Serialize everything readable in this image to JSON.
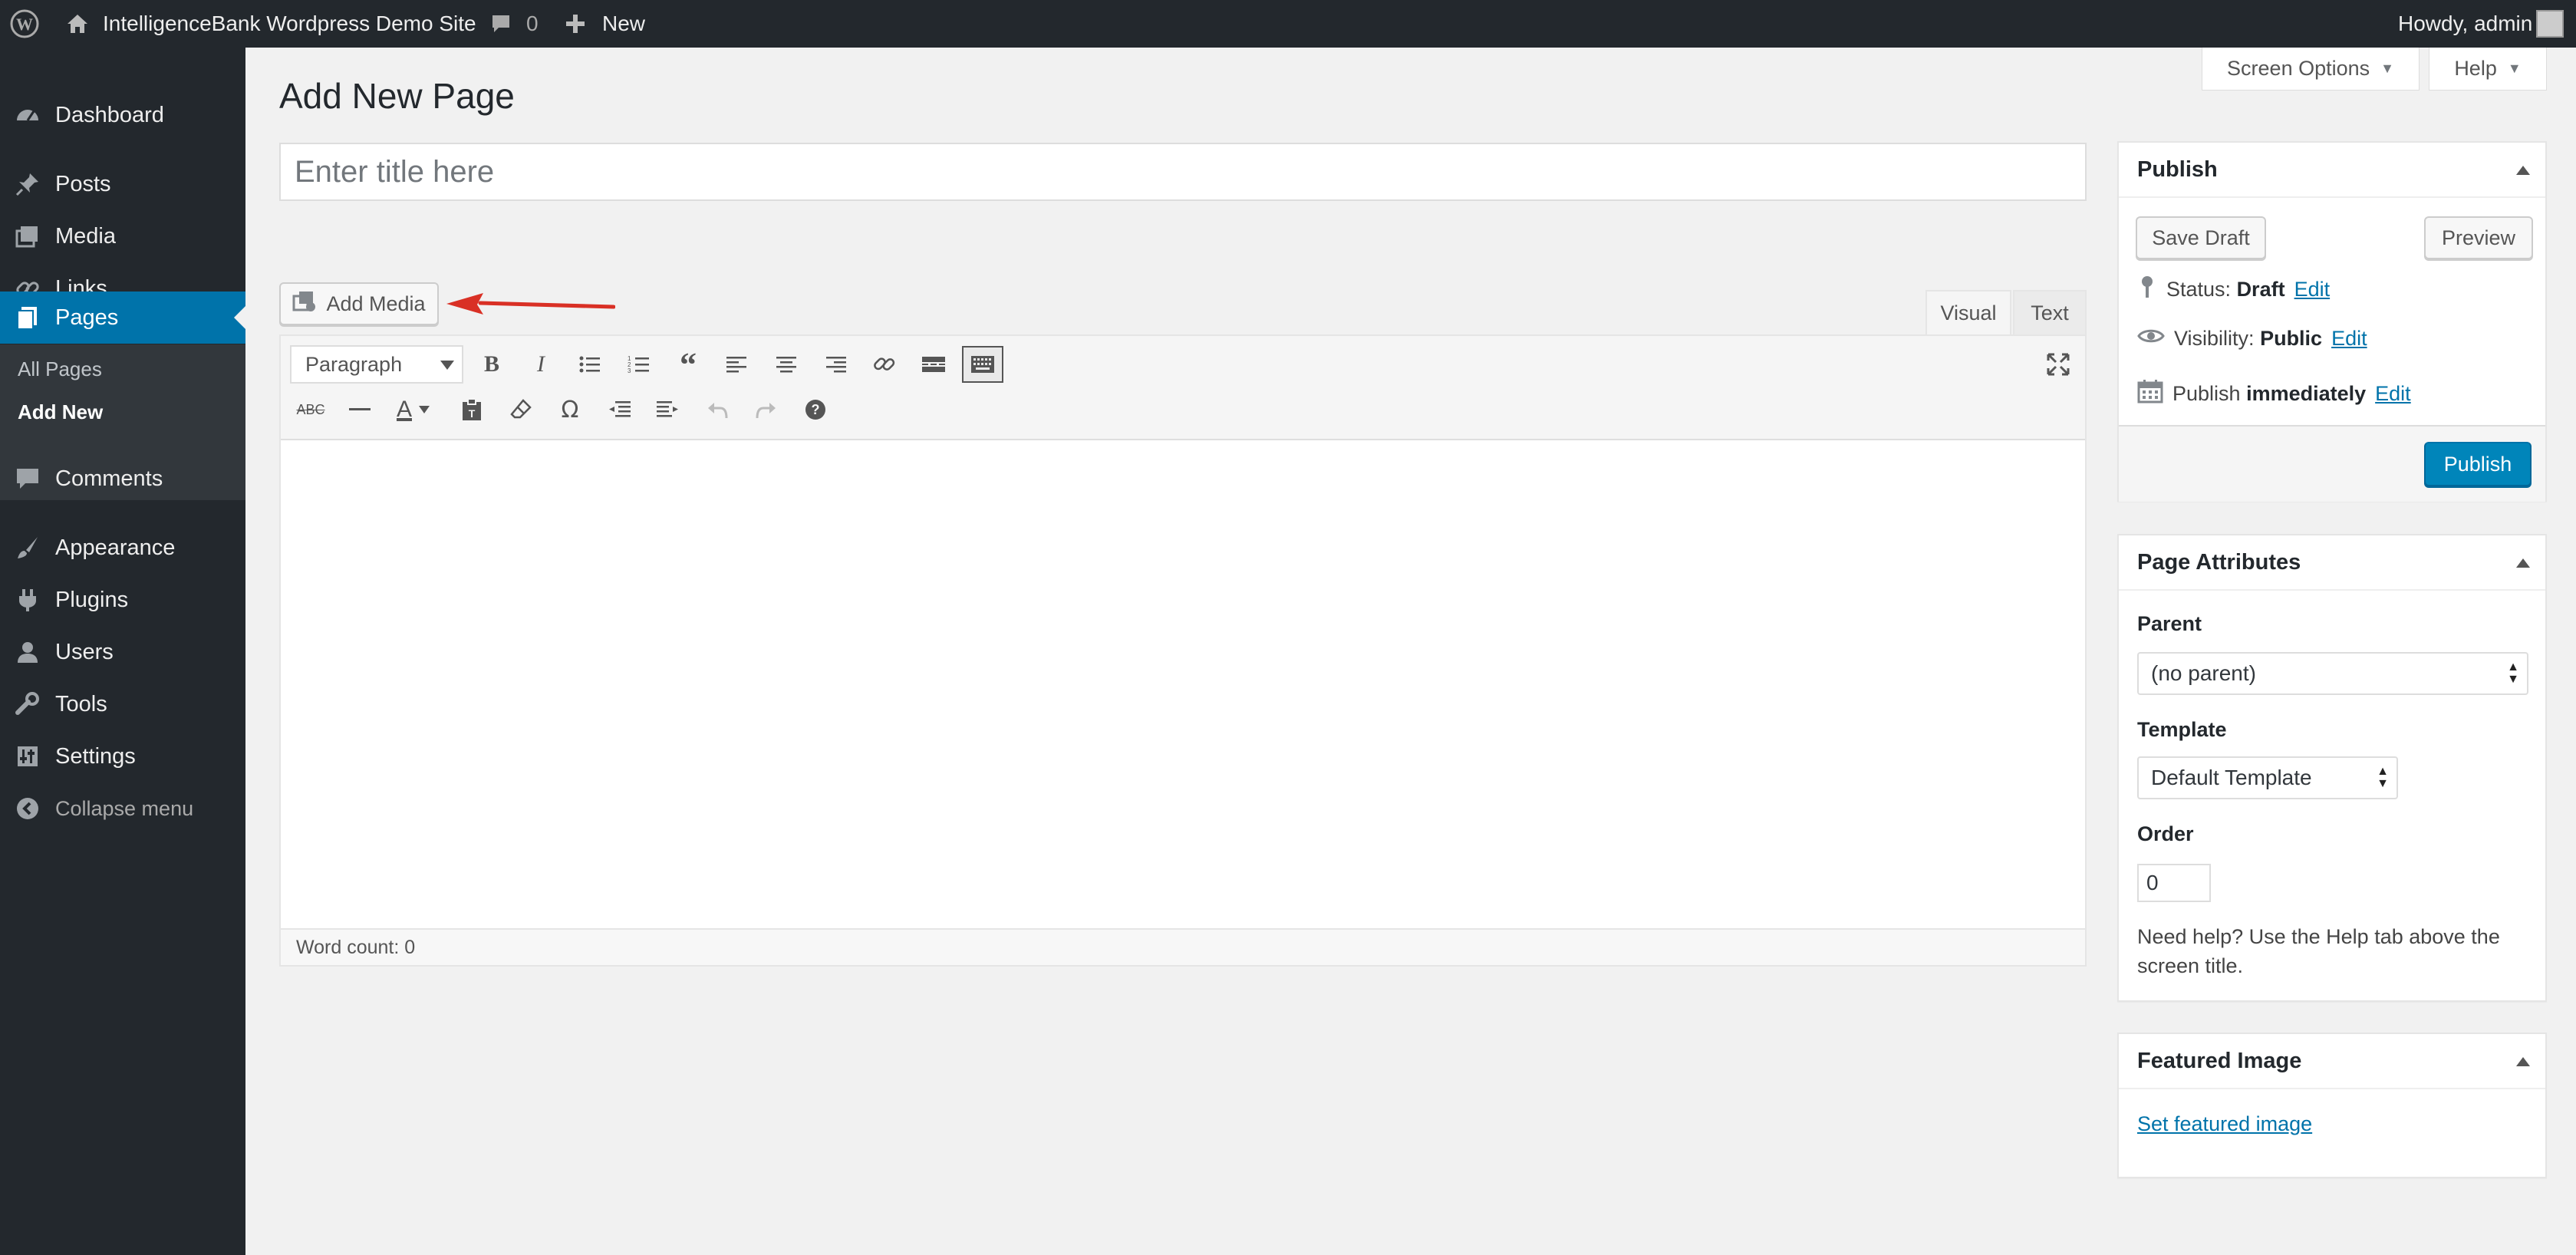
{
  "adminbar": {
    "site_name": "IntelligenceBank Wordpress Demo Site",
    "comments_count": "0",
    "new_label": "New",
    "howdy": "Howdy, admin"
  },
  "menu": {
    "items": [
      {
        "label": "Dashboard",
        "icon": "dashboard-icon"
      },
      {
        "label": "Posts",
        "icon": "pin-icon"
      },
      {
        "label": "Media",
        "icon": "media-icon"
      },
      {
        "label": "Links",
        "icon": "link-icon"
      },
      {
        "label": "Pages",
        "icon": "pages-icon"
      },
      {
        "label": "Comments",
        "icon": "comment-icon"
      },
      {
        "label": "Appearance",
        "icon": "brush-icon"
      },
      {
        "label": "Plugins",
        "icon": "plug-icon"
      },
      {
        "label": "Users",
        "icon": "user-icon"
      },
      {
        "label": "Tools",
        "icon": "wrench-icon"
      },
      {
        "label": "Settings",
        "icon": "settings-icon"
      }
    ],
    "submenu": [
      "All Pages",
      "Add New"
    ],
    "collapse": "Collapse menu"
  },
  "screen_options": "Screen Options",
  "help": "Help",
  "page_title": "Add New Page",
  "title_placeholder": "Enter title here",
  "add_media": "Add Media",
  "editor": {
    "tab_visual": "Visual",
    "tab_text": "Text",
    "format_value": "Paragraph",
    "word_count": "Word count: 0"
  },
  "publish": {
    "heading": "Publish",
    "save_draft": "Save Draft",
    "preview": "Preview",
    "status_label": "Status:",
    "status_value": "Draft",
    "visibility_label": "Visibility:",
    "visibility_value": "Public",
    "publish_label": "Publish",
    "publish_value": "immediately",
    "edit": "Edit",
    "publish_button": "Publish"
  },
  "page_attributes": {
    "heading": "Page Attributes",
    "parent_label": "Parent",
    "parent_value": "(no parent)",
    "template_label": "Template",
    "template_value": "Default Template",
    "order_label": "Order",
    "order_value": "0",
    "help_text": "Need help? Use the Help tab above the screen title."
  },
  "featured_image": {
    "heading": "Featured Image",
    "link": "Set featured image"
  },
  "colors": {
    "admin_dark": "#23282d",
    "accent": "#0073aa",
    "annotation_arrow": "#d93025"
  }
}
